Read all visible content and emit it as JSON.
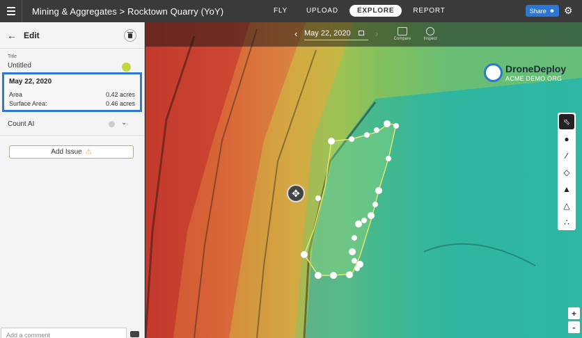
{
  "header": {
    "title": "Mining & Aggregates > Rocktown Quarry (YoY)",
    "nav": [
      "FLY",
      "UPLOAD",
      "EXPLORE",
      "REPORT"
    ],
    "active_nav": "EXPLORE",
    "share_label": "Share"
  },
  "sidebar": {
    "heading": "Edit",
    "title_label": "Title",
    "title_value": "Untitled",
    "annotation_color": "#c5d63c",
    "measurement": {
      "date": "May 22, 2020",
      "area_label": "Area",
      "area_value": "0.42 acres",
      "surface_label": "Surface Area:",
      "surface_value": "0.46 acres"
    },
    "count_ai_label": "Count AI",
    "add_issue_label": "Add Issue",
    "comment_placeholder": "Add a comment"
  },
  "map": {
    "date": "May 22, 2020",
    "compare_label": "Compare",
    "inspect_label": "Inspect",
    "logo_name": "DroneDeploy",
    "logo_sub": "ACME DEMO ORG",
    "tools": [
      "select-icon",
      "pin-icon",
      "line-icon",
      "area-icon",
      "volume-icon",
      "terrain-icon",
      "count-icon"
    ],
    "zoom_in": "+",
    "zoom_out": "-",
    "accent_color": "#2a77d6"
  }
}
